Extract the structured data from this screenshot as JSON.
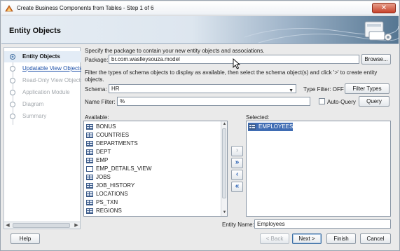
{
  "window": {
    "title": "Create Business Components from Tables - Step 1 of 6",
    "close_glyph": "✕"
  },
  "header": {
    "title": "Entity Objects"
  },
  "nav": {
    "items": [
      {
        "label": "Entity Objects",
        "state": "active"
      },
      {
        "label": "Updatable View Objects",
        "state": "link"
      },
      {
        "label": "Read-Only View Objects",
        "state": "disabled"
      },
      {
        "label": "Application Module",
        "state": "disabled"
      },
      {
        "label": "Diagram",
        "state": "disabled"
      },
      {
        "label": "Summary",
        "state": "disabled"
      }
    ]
  },
  "main": {
    "instruction1": "Specify the package to contain your new entity objects and associations.",
    "package_label": "Package:",
    "package_value": "br.com.waslleysouza.model",
    "browse_label": "Browse...",
    "instruction2": "Filter the types of schema objects to display as available, then select the schema object(s) and click '>' to create entity objects.",
    "schema_label": "Schema:",
    "schema_value": "HR",
    "type_filter_label": "Type Filter: OFF",
    "filter_types_label": "Filter Types",
    "name_filter_label": "Name Filter:",
    "name_filter_value": "%",
    "auto_query_label": "Auto-Query",
    "query_label": "Query",
    "available_label": "Available:",
    "available_items": [
      {
        "name": "BONUS",
        "kind": "table"
      },
      {
        "name": "COUNTRIES",
        "kind": "table"
      },
      {
        "name": "DEPARTMENTS",
        "kind": "table"
      },
      {
        "name": "DEPT",
        "kind": "table"
      },
      {
        "name": "EMP",
        "kind": "table"
      },
      {
        "name": "EMP_DETAILS_VIEW",
        "kind": "view"
      },
      {
        "name": "JOBS",
        "kind": "table"
      },
      {
        "name": "JOB_HISTORY",
        "kind": "table"
      },
      {
        "name": "LOCATIONS",
        "kind": "table"
      },
      {
        "name": "PS_TXN",
        "kind": "table"
      },
      {
        "name": "REGIONS",
        "kind": "table"
      }
    ],
    "selected_label": "Selected:",
    "selected_items": [
      {
        "name": "EMPLOYEES",
        "kind": "table"
      }
    ],
    "shuttle": [
      "›",
      "»",
      "‹",
      "«"
    ],
    "entity_name_label": "Entity Name:",
    "entity_name_value": "Employees"
  },
  "footer": {
    "help": "Help",
    "back": "< Back",
    "next": "Next >",
    "finish": "Finish",
    "cancel": "Cancel"
  }
}
